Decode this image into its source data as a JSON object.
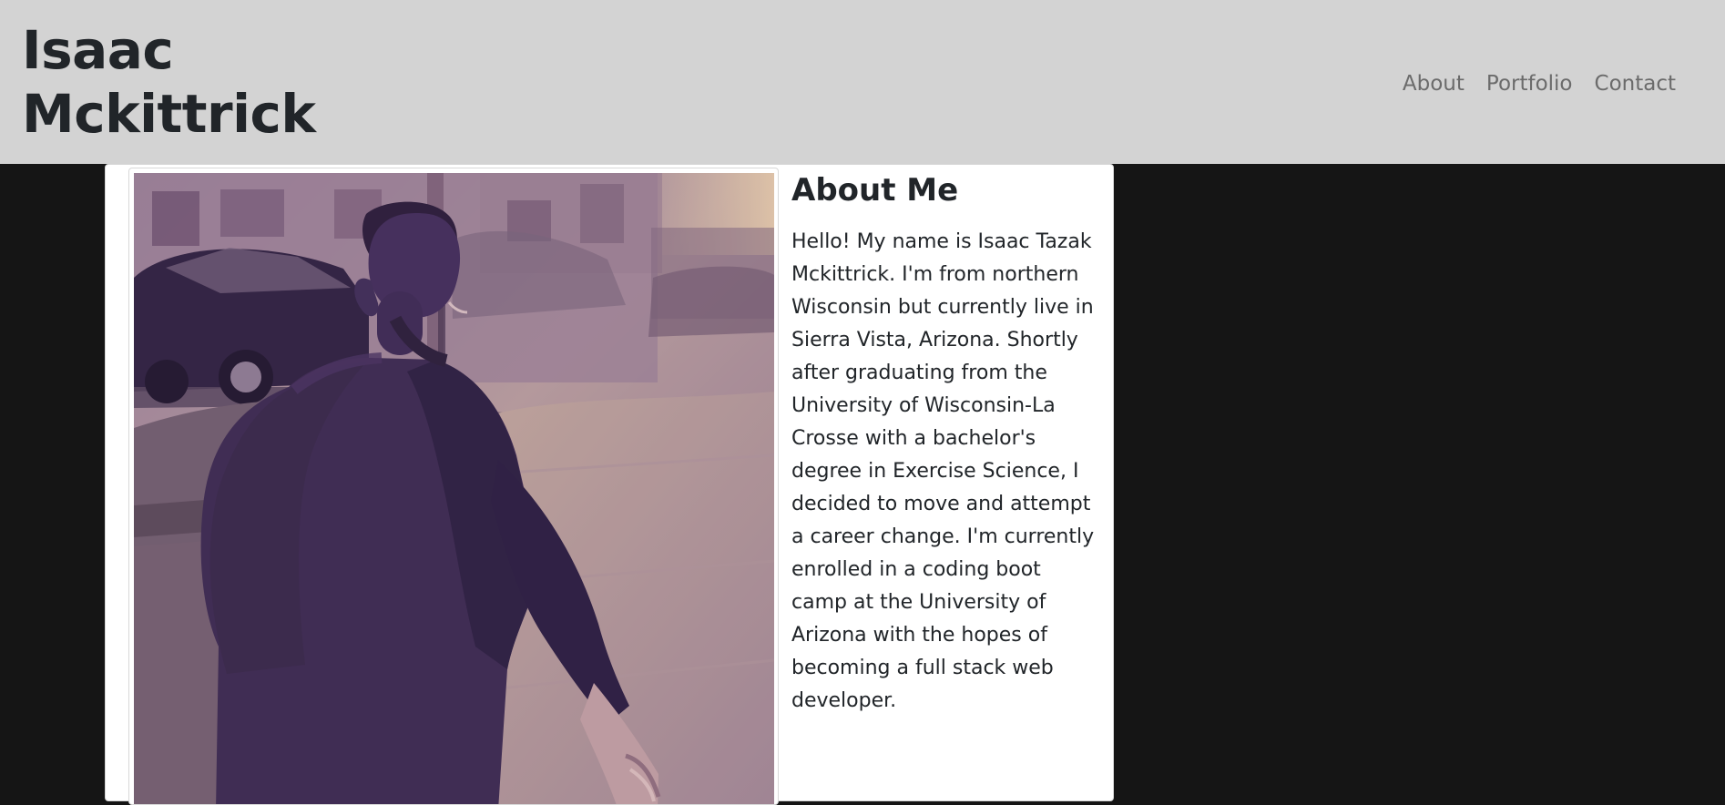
{
  "header": {
    "brand_name": "Isaac Mckittrick",
    "nav_links": [
      {
        "label": "About"
      },
      {
        "label": "Portfolio"
      },
      {
        "label": "Contact"
      }
    ]
  },
  "main": {
    "about_title": "About Me",
    "about_text": "Hello! My name is Isaac Tazak Mckittrick. I'm from northern Wisconsin but currently live in Sierra Vista, Arizona. Shortly after graduating from the University of Wisconsin-La Crosse with a bachelor's degree in Exercise Science, I decided to move and attempt a career change. I'm currently enrolled in a coding boot camp at the University of Arizona with the hopes of becoming a full stack web developer."
  },
  "colors": {
    "header_background": "#d3d3d3",
    "page_background": "#151515",
    "card_background": "#ffffff",
    "photo_tint": "#4b315f"
  }
}
